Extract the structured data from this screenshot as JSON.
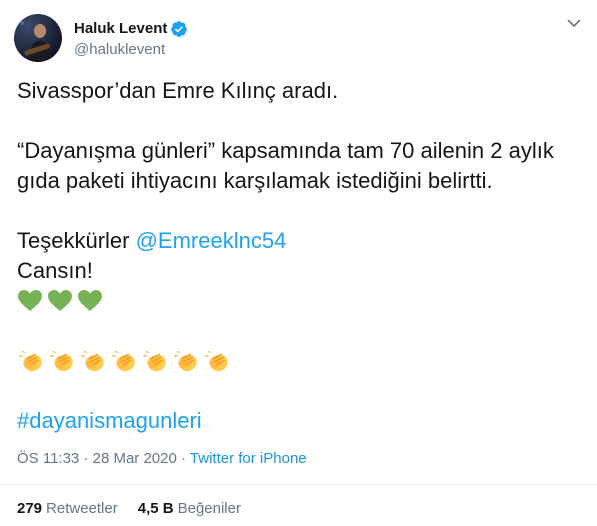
{
  "author": {
    "display_name": "Haluk Levent",
    "handle": "@haluklevent",
    "verified": true
  },
  "tweet": {
    "line1": "Sivasspor’dan Emre Kılınç aradı.",
    "line2": "“Dayanışma günleri” kapsamında tam 70 ailenin 2 aylık",
    "line3": "gıda paketi ihtiyacını karşılamak istediğini belirtti.",
    "line4_prefix": "Teşekkürler ",
    "mention": "@Emreeklnc54",
    "line5": "Cansın!",
    "hashtag": "#dayanismagunleri",
    "green_hearts_count": 3,
    "clapping_hands_count": 7
  },
  "meta": {
    "time": "ÖS 11:33",
    "sep1": " · ",
    "date": "28 Mar 2020",
    "sep2": " · ",
    "source": "Twitter for iPhone"
  },
  "stats": {
    "retweets_count": "279",
    "retweets_label": "Retweetler",
    "likes_count": "4,5 B",
    "likes_label": "Beğeniler"
  },
  "icons": {
    "verified_color": "#1da1f2",
    "heart_color": "#77b255",
    "clap_color": "#ffcc4d"
  }
}
